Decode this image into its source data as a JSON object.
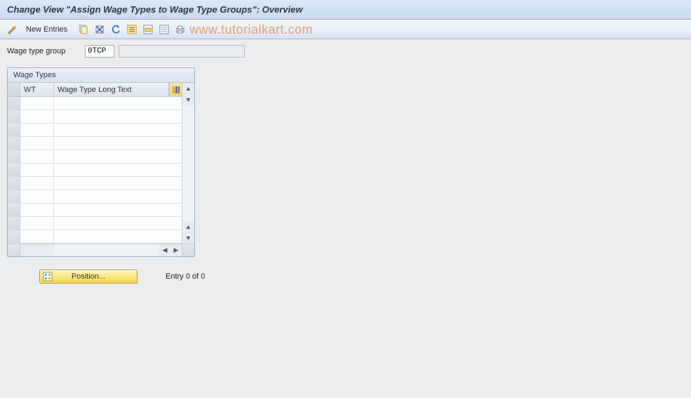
{
  "title": "Change View \"Assign Wage Types to Wage Type Groups\": Overview",
  "toolbar": {
    "new_entries_label": "New Entries"
  },
  "watermark": "www.tutorialkart.com",
  "field": {
    "label": "Wage type group",
    "code": "0TCP",
    "desc": ""
  },
  "table": {
    "title": "Wage Types",
    "col_wt": "WT",
    "col_long": "Wage Type Long Text",
    "rows": [
      {
        "wt": "",
        "long": ""
      },
      {
        "wt": "",
        "long": ""
      },
      {
        "wt": "",
        "long": ""
      },
      {
        "wt": "",
        "long": ""
      },
      {
        "wt": "",
        "long": ""
      },
      {
        "wt": "",
        "long": ""
      },
      {
        "wt": "",
        "long": ""
      },
      {
        "wt": "",
        "long": ""
      },
      {
        "wt": "",
        "long": ""
      },
      {
        "wt": "",
        "long": ""
      },
      {
        "wt": "",
        "long": ""
      }
    ]
  },
  "footer": {
    "position_label": "Position...",
    "entry_text": "Entry 0 of 0"
  }
}
